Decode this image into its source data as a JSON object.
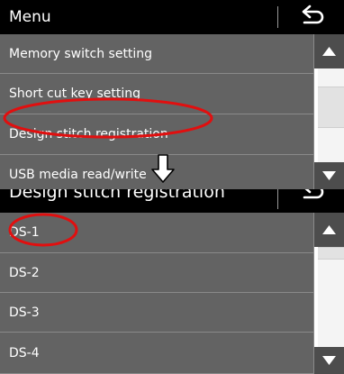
{
  "top_panel": {
    "title": "Menu",
    "items": [
      {
        "label": "Memory switch setting"
      },
      {
        "label": "Short cut key setting"
      },
      {
        "label": "Design stitch registration"
      },
      {
        "label": "USB media read/write"
      }
    ]
  },
  "bottom_panel": {
    "title": "Design stitch registration",
    "items": [
      {
        "label": "DS-1"
      },
      {
        "label": "DS-2"
      },
      {
        "label": "DS-3"
      },
      {
        "label": "DS-4"
      }
    ]
  },
  "icons": {
    "back": "return-arrow-icon",
    "scroll_up": "triangle-up-icon",
    "scroll_down": "triangle-down-icon",
    "transition": "down-arrow-icon"
  },
  "colors": {
    "titlebar": "#000000",
    "item": "#636363",
    "annotation": "#e10f0f"
  }
}
